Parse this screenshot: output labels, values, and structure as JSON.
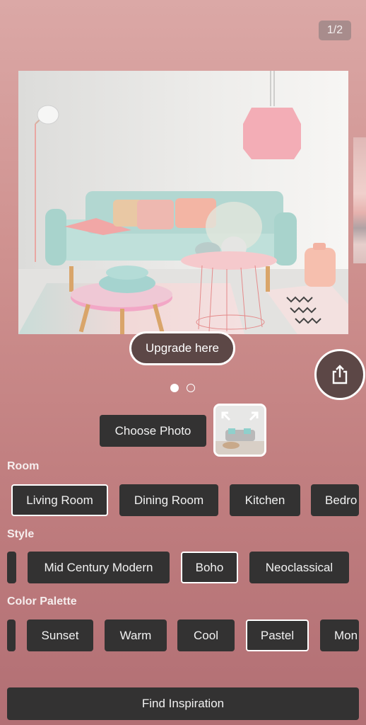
{
  "gallery": {
    "counter": "1/2",
    "image_description": "Pastel living room with mint sofa, patterned cushions, pink pendant lamp, pink side tables and striped rug",
    "upgrade_label": "Upgrade here",
    "share_icon": "share-icon",
    "current_page": 1,
    "total_pages": 2
  },
  "photo": {
    "choose_label": "Choose Photo",
    "thumbnail_description": "Uploaded room photo with expand arrows"
  },
  "room": {
    "label": "Room",
    "options": [
      "Living Room",
      "Dining Room",
      "Kitchen",
      "Bedro"
    ],
    "selected": "Living Room"
  },
  "style": {
    "label": "Style",
    "options": [
      "",
      "Mid Century Modern",
      "Boho",
      "Neoclassical"
    ],
    "selected": "Boho"
  },
  "palette": {
    "label": "Color Palette",
    "options": [
      "",
      "Sunset",
      "Warm",
      "Cool",
      "Pastel",
      "Mon"
    ],
    "selected": "Pastel"
  },
  "actions": {
    "find_label": "Find Inspiration"
  },
  "colors": {
    "chip_bg": "#333232",
    "selected_border": "#ffffff",
    "accent_dark": "#5c4746"
  }
}
